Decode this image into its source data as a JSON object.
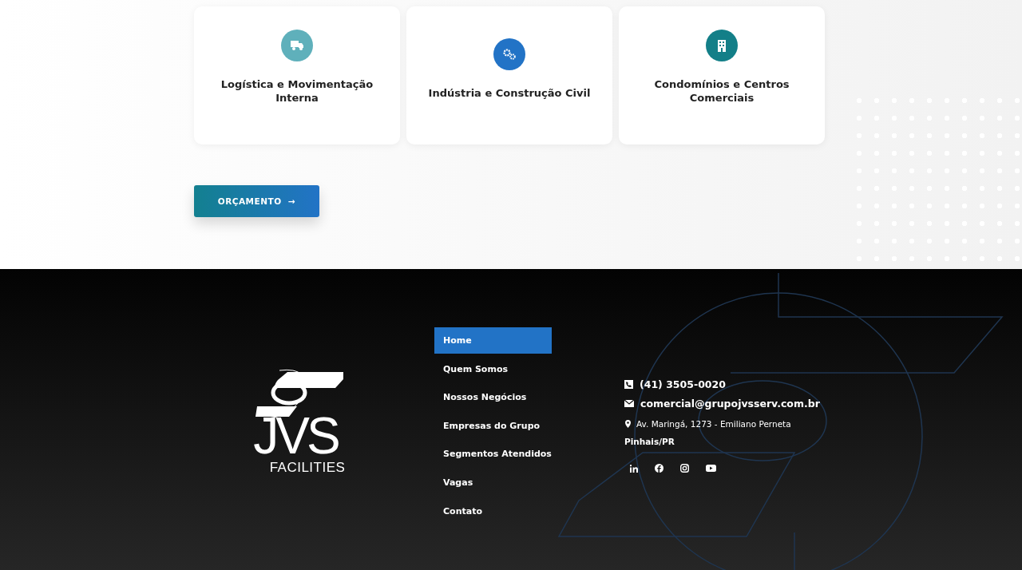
{
  "segments": [
    {
      "kind": "truck",
      "color": "#5fb0bb",
      "title": "Logística e Movimentação Interna"
    },
    {
      "kind": "gears",
      "color": "#2273c6",
      "title": "Indústria e Construção Civil"
    },
    {
      "kind": "building",
      "color": "#137f88",
      "title": "Condomínios e Centros Comerciais"
    }
  ],
  "cta": {
    "label": "ORÇAMENTO",
    "arrow": "→"
  },
  "logo": {
    "mark": "JVS",
    "tagline": "FACILITIES"
  },
  "nav": [
    {
      "label": "Home",
      "selected": true
    },
    {
      "label": "Quem Somos",
      "selected": false
    },
    {
      "label": "Nossos Negócios",
      "selected": false
    },
    {
      "label": "Empresas do Grupo",
      "selected": false
    },
    {
      "label": "Segmentos Atendidos",
      "selected": false
    },
    {
      "label": "Vagas",
      "selected": false
    },
    {
      "label": "Contato",
      "selected": false
    }
  ],
  "contact": {
    "phone": "(41) 3505-0020",
    "email": "comercial@grupojvsserv.com.br",
    "address": "Av. Maringá, 1273 - Emiliano Perneta",
    "city": "Pinhais/PR"
  }
}
